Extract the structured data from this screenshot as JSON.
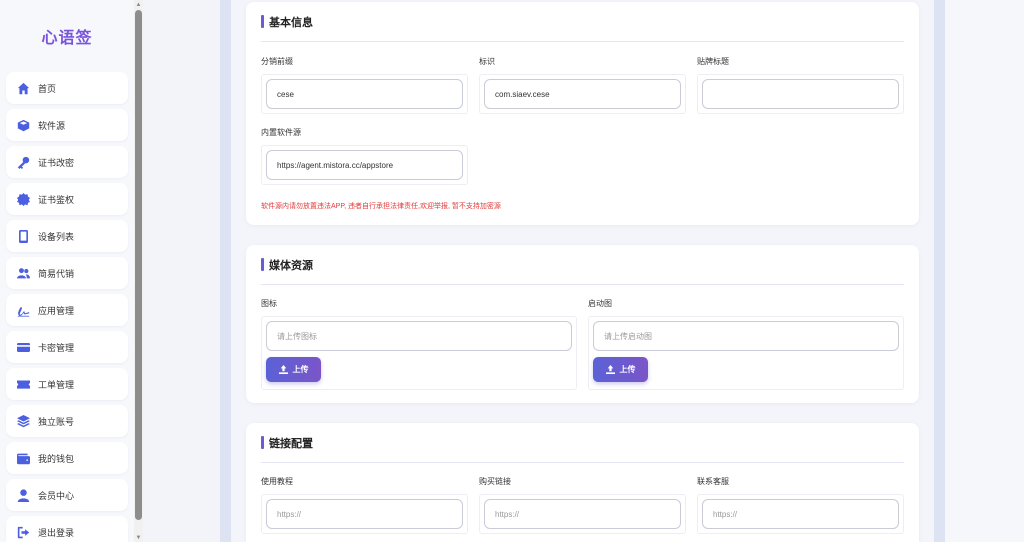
{
  "sidebar": {
    "logo": "心语签",
    "items": [
      {
        "label": "首页",
        "icon": "home-icon"
      },
      {
        "label": "软件源",
        "icon": "cube-icon"
      },
      {
        "label": "证书改密",
        "icon": "key-icon"
      },
      {
        "label": "证书鉴权",
        "icon": "certificate-icon"
      },
      {
        "label": "设备列表",
        "icon": "mobile-icon"
      },
      {
        "label": "简易代销",
        "icon": "users-icon"
      },
      {
        "label": "应用管理",
        "icon": "signature-icon"
      },
      {
        "label": "卡密管理",
        "icon": "card-icon"
      },
      {
        "label": "工单管理",
        "icon": "ticket-icon"
      },
      {
        "label": "独立账号",
        "icon": "layers-icon"
      },
      {
        "label": "我的钱包",
        "icon": "wallet-icon"
      },
      {
        "label": "会员中心",
        "icon": "user-icon"
      },
      {
        "label": "退出登录",
        "icon": "logout-icon"
      }
    ]
  },
  "basic_info": {
    "title": "基本信息",
    "prefix": {
      "label": "分销前缀",
      "value": "cese"
    },
    "identifier": {
      "label": "标识",
      "value": "com.siaev.cese"
    },
    "tag_title": {
      "label": "贴牌标题",
      "value": ""
    },
    "builtin_source": {
      "label": "内置软件源",
      "value": "https://agent.mistora.cc/appstore"
    },
    "warning": "软件源内请勿放置违法APP, 违者自行承担法律责任,欢迎举报, 暂不支持加密源"
  },
  "media": {
    "title": "媒体资源",
    "icon_field": {
      "label": "图标",
      "placeholder": "请上传图标",
      "button": "上传"
    },
    "splash_field": {
      "label": "启动图",
      "placeholder": "请上传启动图",
      "button": "上传"
    }
  },
  "links": {
    "title": "链接配置",
    "tutorial": {
      "label": "使用教程",
      "placeholder": "https://"
    },
    "purchase": {
      "label": "购买链接",
      "placeholder": "https://"
    },
    "support": {
      "label": "联系客服",
      "placeholder": "https://"
    }
  },
  "colors": {
    "accent": "#6a5bd6",
    "logo": "#7a55dc",
    "warning": "#e03a3a",
    "icon": "#4b5fe0"
  }
}
